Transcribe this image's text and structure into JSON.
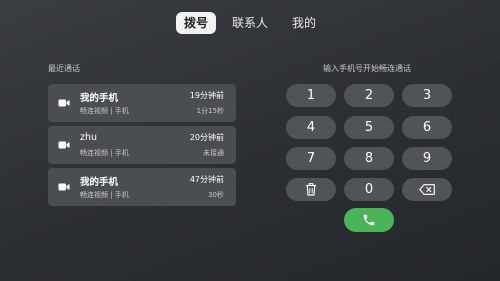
{
  "tabs": [
    {
      "label": "拨号",
      "active": true
    },
    {
      "label": "联系人",
      "active": false
    },
    {
      "label": "我的",
      "active": false
    }
  ],
  "recent": {
    "title": "最近通话",
    "items": [
      {
        "name": "我的手机",
        "sub": "畅连视频 | 手机",
        "time": "19分钟前",
        "duration": "1分15秒"
      },
      {
        "name": "zhu",
        "sub": "畅连视频 | 手机",
        "time": "20分钟前",
        "duration": "未接通"
      },
      {
        "name": "我的手机",
        "sub": "畅连视频 | 手机",
        "time": "47分钟前",
        "duration": "30秒"
      }
    ]
  },
  "dialpad": {
    "hint": "输入手机号开始畅连通话",
    "keys": [
      "1",
      "2",
      "3",
      "4",
      "5",
      "6",
      "7",
      "8",
      "9",
      "0"
    ]
  },
  "colors": {
    "call": "#4ab556",
    "key": "#505358",
    "card": "#4a4d52"
  },
  "icons": {
    "camera": "video-camera-icon",
    "delete": "trash-icon",
    "backspace": "backspace-icon",
    "phone": "phone-icon"
  }
}
